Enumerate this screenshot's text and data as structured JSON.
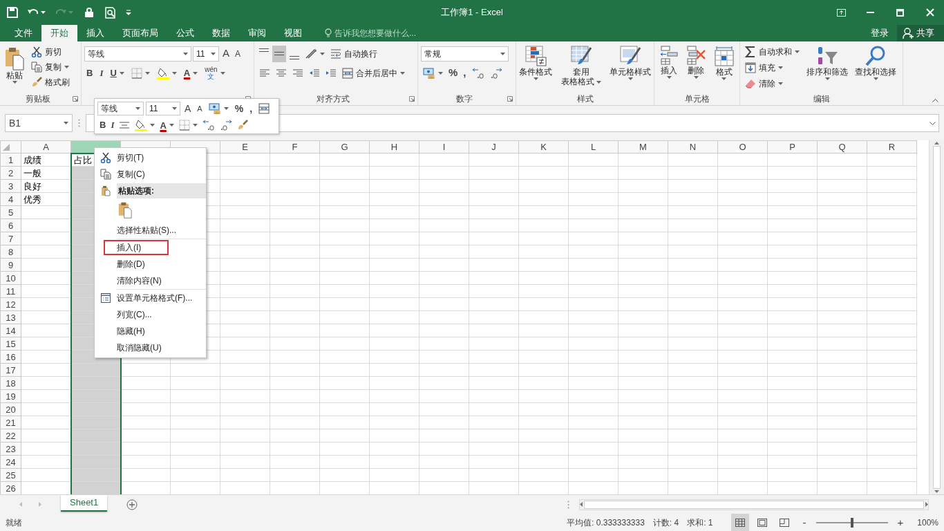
{
  "window": {
    "title": "工作簿1 - Excel"
  },
  "ribbon_tabs": [
    {
      "label": "文件",
      "selected": false
    },
    {
      "label": "开始",
      "selected": true
    },
    {
      "label": "插入",
      "selected": false
    },
    {
      "label": "页面布局",
      "selected": false
    },
    {
      "label": "公式",
      "selected": false
    },
    {
      "label": "数据",
      "selected": false
    },
    {
      "label": "审阅",
      "selected": false
    },
    {
      "label": "视图",
      "selected": false
    }
  ],
  "tell_me": {
    "placeholder": "告诉我您想要做什么..."
  },
  "account": {
    "sign_in": "登录",
    "share": "共享"
  },
  "ribbon_groups": [
    {
      "kind": "clipboard",
      "label": "剪贴板",
      "paste": "粘贴",
      "cut": "剪切",
      "copy": "复制",
      "painter": "格式刷"
    },
    {
      "kind": "font",
      "font": "等线",
      "size": "11",
      "grow": "A",
      "shrink": "A",
      "bold": "B",
      "italic": "I",
      "underline": "U",
      "font_color": "A",
      "phonetic_top": "wén",
      "phonetic_bottom": "文"
    },
    {
      "kind": "alignment",
      "label": "对齐方式",
      "wrap": "自动换行",
      "merge": "合并后居中",
      "vertical": [
        {
          "selected": false
        },
        {
          "selected": true
        },
        {
          "selected": false
        }
      ]
    },
    {
      "kind": "number",
      "label": "数字",
      "format": "常规",
      "percent": "%",
      "comma": ","
    },
    {
      "kind": "styles",
      "label": "样式",
      "conditional": "条件格式",
      "table_top": "套用",
      "table_bottom": "表格格式",
      "cell_styles": "单元格样式"
    },
    {
      "kind": "cells",
      "label": "单元格",
      "insert": "插入",
      "delete": "删除",
      "format": "格式"
    },
    {
      "kind": "editing",
      "label": "编辑",
      "autosum": "自动求和",
      "fill": "填充",
      "clear": "清除",
      "sort": "排序和筛选",
      "find": "查找和选择"
    }
  ],
  "name_box": {
    "value": "B1"
  },
  "mini_toolbar": {
    "font": "等线",
    "size": "11",
    "grow": "A",
    "shrink": "A",
    "percent": "%",
    "comma": ",",
    "bold": "B",
    "italic": "I",
    "font_color": "A"
  },
  "sheet": {
    "columns": [
      {
        "label": "A",
        "selected": false
      },
      {
        "selected": true
      },
      {
        "selected": false
      },
      {
        "selected": false
      },
      {
        "label": "E",
        "selected": false
      },
      {
        "label": "F",
        "selected": false
      },
      {
        "label": "G",
        "selected": false
      },
      {
        "label": "H",
        "selected": false
      },
      {
        "label": "I",
        "selected": false
      },
      {
        "label": "J",
        "selected": false
      },
      {
        "label": "K",
        "selected": false
      },
      {
        "label": "L",
        "selected": false
      },
      {
        "label": "M",
        "selected": false
      },
      {
        "label": "N",
        "selected": false
      },
      {
        "label": "O",
        "selected": false
      },
      {
        "label": "P",
        "selected": false
      },
      {
        "label": "Q",
        "selected": false
      },
      {
        "label": "R",
        "selected": false
      }
    ],
    "rows": [
      {
        "label": "1",
        "cells": [
          {
            "text": "成绩",
            "active": false
          },
          {
            "text": "占比",
            "active": true
          }
        ]
      },
      {
        "label": "2",
        "cells": [
          {
            "text": "一般",
            "active": false
          }
        ]
      },
      {
        "label": "3",
        "cells": [
          {
            "text": "良好",
            "active": false
          }
        ]
      },
      {
        "label": "4",
        "cells": [
          {
            "text": "优秀",
            "active": false
          }
        ]
      },
      {
        "label": "5"
      },
      {
        "label": "6"
      },
      {
        "label": "7"
      },
      {
        "label": "8"
      },
      {
        "label": "9"
      },
      {
        "label": "10"
      },
      {
        "label": "11"
      },
      {
        "label": "12"
      },
      {
        "label": "13"
      },
      {
        "label": "14"
      },
      {
        "label": "15"
      },
      {
        "label": "16"
      },
      {
        "label": "17"
      },
      {
        "label": "18"
      },
      {
        "label": "19"
      },
      {
        "label": "20"
      },
      {
        "label": "21"
      },
      {
        "label": "22"
      },
      {
        "label": "23"
      },
      {
        "label": "24"
      },
      {
        "label": "25"
      },
      {
        "label": "26"
      }
    ]
  },
  "context_menu": {
    "sections": [
      {
        "items": [
          {
            "kind": "cut",
            "label": "剪切(T)",
            "annotated": false
          },
          {
            "kind": "copy",
            "label": "复制(C)",
            "annotated": false
          },
          {
            "kind": "header",
            "label": "粘贴选项:",
            "annotated": false
          },
          {
            "kind": "paste_option",
            "annotated": false
          },
          {
            "kind": "plain",
            "label": "选择性粘贴(S)...",
            "annotated": false
          }
        ]
      },
      {
        "items": [
          {
            "kind": "plain",
            "label": "插入(I)",
            "annotated": true
          },
          {
            "kind": "plain",
            "label": "删除(D)",
            "annotated": false
          },
          {
            "kind": "plain",
            "label": "清除内容(N)",
            "annotated": false
          }
        ]
      },
      {
        "items": [
          {
            "kind": "format",
            "label": "设置单元格格式(F)...",
            "annotated": false
          },
          {
            "kind": "plain",
            "label": "列宽(C)...",
            "annotated": false
          },
          {
            "kind": "plain",
            "label": "隐藏(H)",
            "annotated": false
          },
          {
            "kind": "plain",
            "label": "取消隐藏(U)",
            "annotated": false
          }
        ]
      }
    ]
  },
  "sheet_tabs": [
    {
      "label": "Sheet1",
      "selected": true
    }
  ],
  "status_bar": {
    "ready": "就绪",
    "average": "平均值: 0.333333333",
    "count": "计数: 4",
    "sum": "求和: 1",
    "zoom_out": "-",
    "zoom_in": "+",
    "zoom": "100%",
    "views": [
      {
        "kind": "normal",
        "selected": true
      },
      {
        "kind": "page_layout",
        "selected": false
      },
      {
        "kind": "page_break",
        "selected": false
      }
    ],
    "zoom_slider": {
      "level": 0.5
    }
  }
}
